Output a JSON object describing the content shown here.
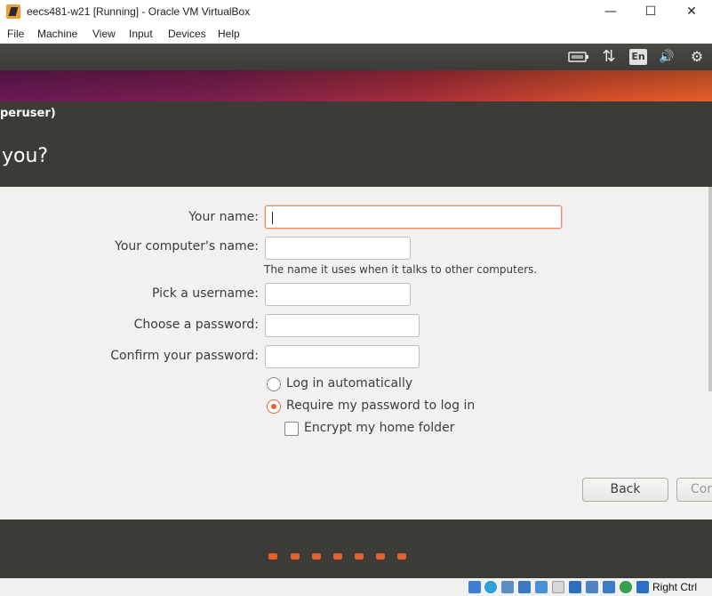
{
  "window": {
    "title": "eecs481-w21 [Running] - Oracle VM VirtualBox",
    "minimize": "—",
    "maximize": "☐",
    "close": "✕"
  },
  "menu": {
    "items": [
      "File",
      "Machine",
      "Input",
      "Devices",
      "Help",
      "View"
    ],
    "file": "File",
    "machine": "Machine",
    "view": "View",
    "input": "Input",
    "devices": "Devices",
    "help": "Help"
  },
  "panel": {
    "language": "En",
    "network_glyph": "⇅",
    "volume_glyph": "🔊",
    "settings_glyph": "⚙",
    "battery_icon": "battery-icon",
    "network_icon": "network-icon",
    "volume_icon": "volume-icon",
    "settings_icon": "gear-icon"
  },
  "header": {
    "subtitle": "peruser)",
    "title": "you?"
  },
  "form": {
    "your_name_label": "Your name:",
    "your_name_value": "",
    "computer_name_label": "Your computer's name:",
    "computer_name_value": "",
    "computer_name_hint": "The name it uses when it talks to other computers.",
    "username_label": "Pick a username:",
    "username_value": "",
    "password_label": "Choose a password:",
    "password_value": "",
    "confirm_label": "Confirm your password:",
    "confirm_value": "",
    "login_auto_label": "Log in automatically",
    "require_password_label": "Require my password to log in",
    "encrypt_label": "Encrypt my home folder",
    "selected_login_option": "Require my password to log in",
    "encrypt_checked": false
  },
  "buttons": {
    "back": "Back",
    "continue": "Con"
  },
  "progress": {
    "steps": 7
  },
  "statusbar": {
    "host_key": "Right Ctrl"
  },
  "colors": {
    "accent": "#e9602c",
    "header_bg": "#3c3b37",
    "content_bg": "#f2f1f0",
    "focus_border": "#e98b60"
  }
}
